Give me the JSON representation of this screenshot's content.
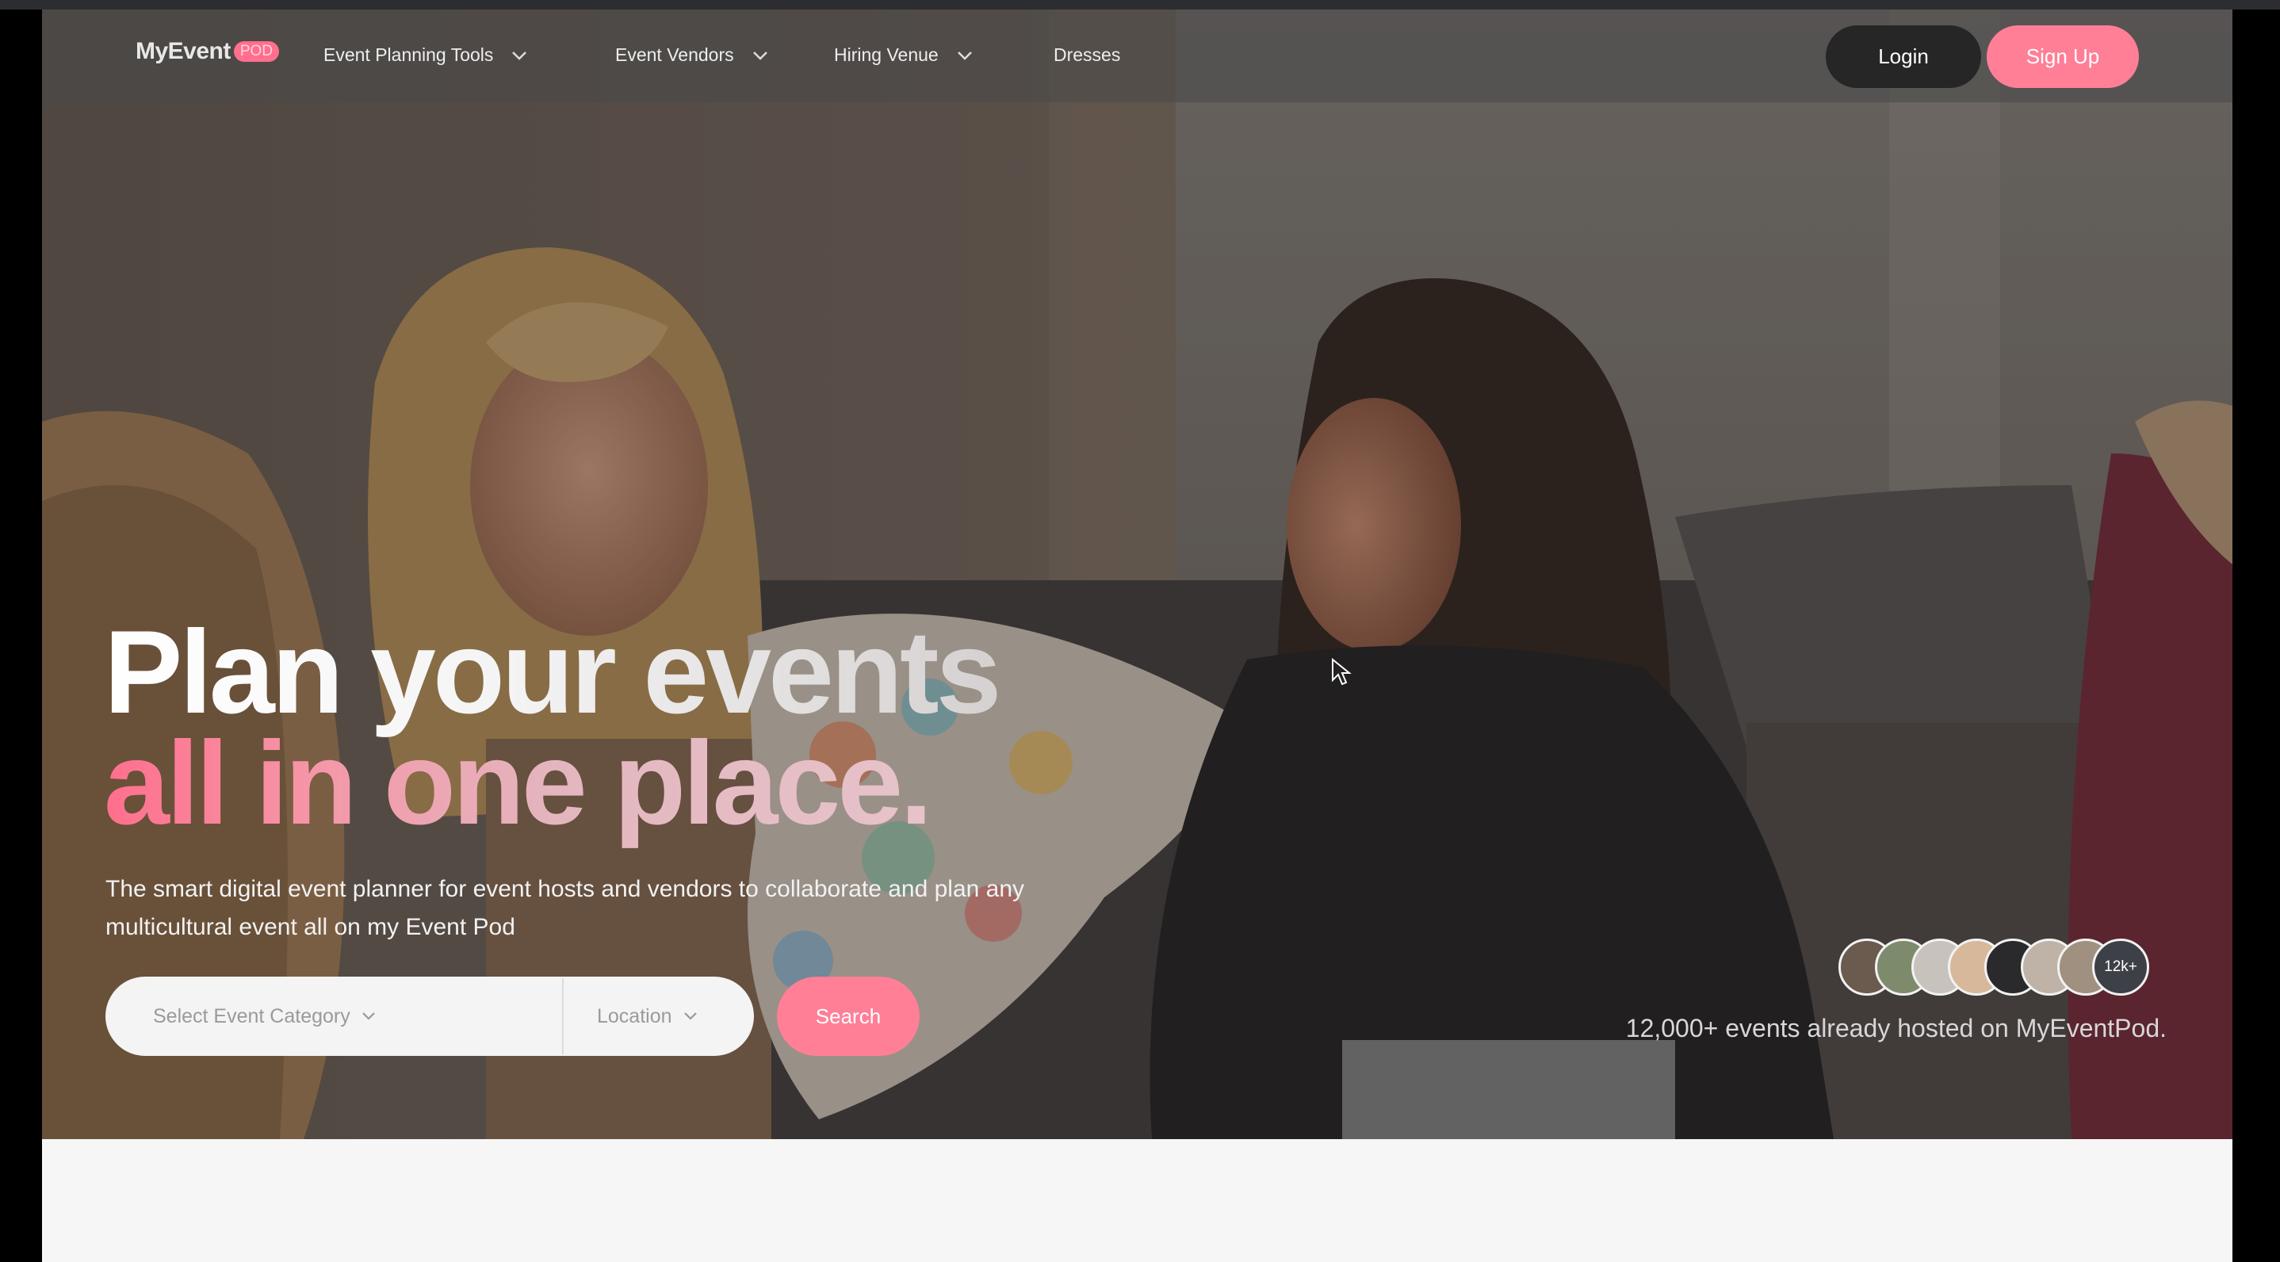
{
  "brand": {
    "name": "MyEvent",
    "badge": "POD"
  },
  "nav": {
    "items": [
      {
        "label": "Event Planning Tools",
        "dropdown": true
      },
      {
        "label": "Event Vendors",
        "dropdown": true
      },
      {
        "label": "Hiring Venue",
        "dropdown": true
      },
      {
        "label": "Dresses",
        "dropdown": false
      }
    ],
    "login_label": "Login",
    "signup_label": "Sign Up"
  },
  "hero": {
    "headline_line1": "Plan your events",
    "headline_line2": "all in one place.",
    "subheading": "The smart digital event planner for event hosts and vendors to collaborate and plan any multicultural event all on my Event Pod",
    "search": {
      "category_placeholder": "Select Event Category",
      "location_placeholder": "Location",
      "button_label": "Search"
    },
    "social_proof": {
      "count_badge": "12k+",
      "text": "12,000+ events already hosted on MyEventPod."
    }
  },
  "colors": {
    "accent": "#ff7f97",
    "dark_button": "#262626",
    "headline_pink": "#ff6f8c"
  }
}
